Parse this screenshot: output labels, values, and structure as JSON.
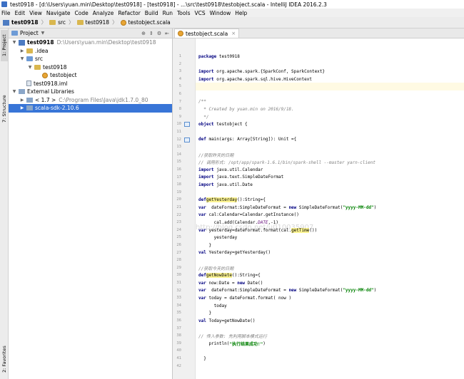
{
  "window": {
    "title": "test0918 - [d:\\Users\\yuan.min\\Desktop\\test0918] - [test0918] - ...\\src\\test0918\\testobject.scala - IntelliJ IDEA 2016.2.3"
  },
  "menu": [
    "File",
    "Edit",
    "View",
    "Navigate",
    "Code",
    "Analyze",
    "Refactor",
    "Build",
    "Run",
    "Tools",
    "VCS",
    "Window",
    "Help"
  ],
  "breadcrumb": [
    {
      "label": "test0918",
      "bold": true,
      "icon": "project"
    },
    {
      "label": "src",
      "icon": "folder"
    },
    {
      "label": "test0918",
      "icon": "folder"
    },
    {
      "label": "testobject.scala",
      "icon": "scala"
    }
  ],
  "side_tabs": {
    "project": "1: Project",
    "structure": "7: Structure",
    "favorites": "2: Favorites"
  },
  "project_panel": {
    "title": "Project",
    "tree": [
      {
        "depth": 0,
        "arrow": "▼",
        "icon": "project",
        "label": "test0918",
        "bold": true,
        "path": "D:\\Users\\yuan.min\\Desktop\\test0918"
      },
      {
        "depth": 1,
        "arrow": "▶",
        "icon": "folder",
        "label": ".idea",
        "path": ""
      },
      {
        "depth": 1,
        "arrow": "▼",
        "icon": "folder-blue",
        "label": "src",
        "path": ""
      },
      {
        "depth": 2,
        "arrow": "▼",
        "icon": "folder",
        "label": "test0918",
        "path": ""
      },
      {
        "depth": 3,
        "arrow": "",
        "icon": "scala",
        "label": "testobject",
        "path": ""
      },
      {
        "depth": 1,
        "arrow": "",
        "icon": "iml",
        "label": "test0918.iml",
        "path": ""
      },
      {
        "depth": 0,
        "arrow": "▼",
        "icon": "lib",
        "label": "External Libraries",
        "path": ""
      },
      {
        "depth": 1,
        "arrow": "▶",
        "icon": "lib",
        "label": "< 1.7 >",
        "path": "C:\\Program Files\\Java\\jdk1.7.0_80"
      },
      {
        "depth": 1,
        "arrow": "▶",
        "icon": "lib",
        "label": "scala-sdk-2.10.6",
        "path": "",
        "selected": true
      }
    ]
  },
  "editor": {
    "tab_label": "testobject.scala",
    "watermark": "http://blog.csdn.net/u010035907",
    "lines": [
      {
        "n": "1",
        "html": "<span class='kw'>package</span> test0918"
      },
      {
        "n": "2",
        "html": ""
      },
      {
        "n": "3",
        "html": "<span class='kw'>import</span> org.apache.spark.{SparkConf, SparkContext}"
      },
      {
        "n": "4",
        "html": "<span class='kw'>import</span> org.apache.spark.sql.hive.HiveContext"
      },
      {
        "n": "5",
        "html": "",
        "current": true
      },
      {
        "n": "6",
        "html": ""
      },
      {
        "n": "7",
        "html": "<span class='cmt'>/**</span>"
      },
      {
        "n": "8",
        "html": "<span class='cmt'>  * Created by yuan.min on 2016/9/18.</span>"
      },
      {
        "n": "9",
        "html": "<span class='cmt'>  */</span>"
      },
      {
        "n": "10",
        "html": "<span class='kw'>object</span> testobject {",
        "marker": true
      },
      {
        "n": "11",
        "html": ""
      },
      {
        "n": "12",
        "html": "  <span class='kw'>def</span> main(args: Array[String]): Unit ={",
        "marker": true
      },
      {
        "n": "13",
        "html": ""
      },
      {
        "n": "14",
        "html": "    <span class='cmt'>//获取昨天的日期</span>"
      },
      {
        "n": "15",
        "html": "    <span class='cmt'>// 调用形式: /opt/app/spark-1.6.1/bin/spark-shell --master yarn-client</span>"
      },
      {
        "n": "16",
        "html": "    <span class='kw'>import</span> java.util.Calendar"
      },
      {
        "n": "17",
        "html": "    <span class='kw'>import</span> java.text.SimpleDateFormat"
      },
      {
        "n": "18",
        "html": "    <span class='kw'>import</span> java.util.Date"
      },
      {
        "n": "19",
        "html": ""
      },
      {
        "n": "20",
        "html": "    <span class='kw'>def</span> <span class='hl'>getYesterday</span>():String={"
      },
      {
        "n": "21",
        "html": "      <span class='kw'>var</span>  dateFormat:SimpleDateFormat = <span class='kw'>new</span> SimpleDateFormat(<span class='str'>\"yyyy-MM-dd\"</span>)"
      },
      {
        "n": "22",
        "html": "      <span class='kw'>var</span> cal:Calendar=Calendar.getInstance()"
      },
      {
        "n": "23",
        "html": "      cal.add(Calendar.<span class='fld'>DATE</span>,-1)"
      },
      {
        "n": "24",
        "html": "      <span class='kw'>var</span> yesterday=dateFormat.format(cal.<span class='hl'>getTime</span>())"
      },
      {
        "n": "25",
        "html": "      yesterday"
      },
      {
        "n": "26",
        "html": "    }"
      },
      {
        "n": "27",
        "html": "    <span class='kw'>val</span> Yesterday=getYesterday()"
      },
      {
        "n": "28",
        "html": ""
      },
      {
        "n": "29",
        "html": "    <span class='cmt'>//获取今天的日期</span>"
      },
      {
        "n": "30",
        "html": "    <span class='kw'>def</span> <span class='hl'>getNowDate</span>():String={"
      },
      {
        "n": "31",
        "html": "      <span class='kw'>var</span> now:Date = <span class='kw'>new</span> Date()"
      },
      {
        "n": "32",
        "html": "      <span class='kw'>var</span>  dateFormat:SimpleDateFormat = <span class='kw'>new</span> SimpleDateFormat(<span class='str'>\"yyyy-MM-dd\"</span>)"
      },
      {
        "n": "33",
        "html": "      <span class='kw'>var</span> today = dateFormat.format( now )"
      },
      {
        "n": "34",
        "html": "      today"
      },
      {
        "n": "35",
        "html": "    }"
      },
      {
        "n": "36",
        "html": "    <span class='kw'>val</span> Today=getNowDate()"
      },
      {
        "n": "37",
        "html": ""
      },
      {
        "n": "38",
        "html": "    <span class='cmt'>// 传入参数: 先利用脚本模式运行</span>"
      },
      {
        "n": "39",
        "html": "    println(<span class='str'>\"执行结果成功!\"</span>)"
      },
      {
        "n": "40",
        "html": ""
      },
      {
        "n": "41",
        "html": "  }"
      },
      {
        "n": "42",
        "html": ""
      }
    ]
  }
}
